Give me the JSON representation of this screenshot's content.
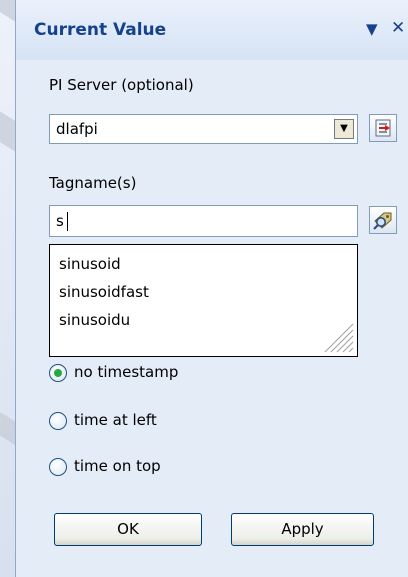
{
  "panel": {
    "title": "Current Value",
    "dropdown_glyph": "▼",
    "close_glyph": "✕"
  },
  "server": {
    "label": "PI Server (optional)",
    "value": "dlafpi",
    "arrow_glyph": "▼",
    "connect_icon": "server-connect-icon"
  },
  "tags": {
    "label": "Tagname(s)",
    "value": "s",
    "search_icon": "tag-search-icon",
    "suggestions": [
      "sinusoid",
      "sinusoidfast",
      "sinusoidu"
    ]
  },
  "timestamp_options": [
    {
      "label": "no timestamp",
      "selected": true
    },
    {
      "label": "time at left",
      "selected": false
    },
    {
      "label": "time on top",
      "selected": false
    }
  ],
  "buttons": {
    "ok": "OK",
    "apply": "Apply"
  },
  "colors": {
    "title_text": "#15428b",
    "panel_bg": "#e4ecf7",
    "radio_selected": "#27a843"
  }
}
